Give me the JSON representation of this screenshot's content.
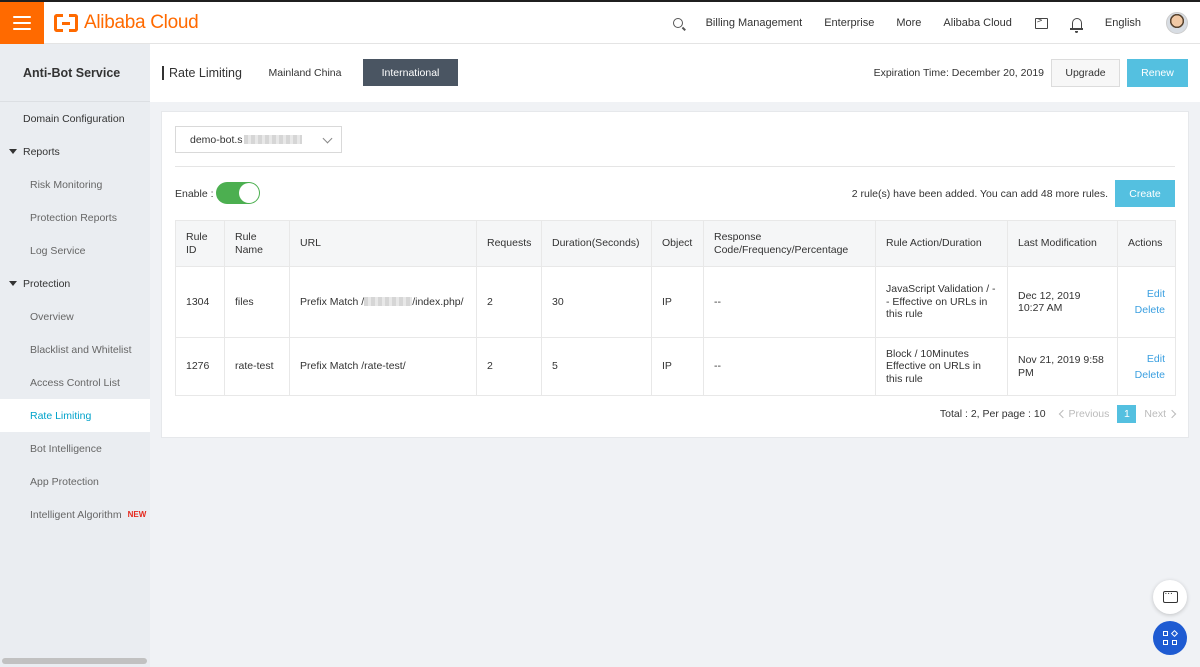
{
  "topbar": {
    "brand": "Alibaba Cloud",
    "nav": [
      "Billing Management",
      "Enterprise",
      "More",
      "Alibaba Cloud"
    ],
    "language": "English"
  },
  "sidebar": {
    "title": "Anti-Bot Service",
    "items": [
      {
        "label": "Domain Configuration"
      },
      {
        "label": "Reports"
      },
      {
        "label": "Risk Monitoring"
      },
      {
        "label": "Protection Reports"
      },
      {
        "label": "Log Service"
      },
      {
        "label": "Protection"
      },
      {
        "label": "Overview"
      },
      {
        "label": "Blacklist and Whitelist"
      },
      {
        "label": "Access Control List"
      },
      {
        "label": "Rate Limiting"
      },
      {
        "label": "Bot Intelligence"
      },
      {
        "label": "App Protection"
      },
      {
        "label": "Intelligent Algorithm",
        "badge": "NEW"
      }
    ]
  },
  "header": {
    "title": "Rate Limiting",
    "regions": [
      "Mainland China",
      "International"
    ],
    "expiration": "Expiration Time: December 20, 2019",
    "upgrade": "Upgrade",
    "renew": "Renew"
  },
  "main": {
    "domain_prefix": "demo-bot.s",
    "enable_label": "Enable :",
    "rule_count": "2 rule(s) have been added. You can add 48 more rules.",
    "create": "Create",
    "columns": [
      "Rule ID",
      "Rule Name",
      "URL",
      "Requests",
      "Duration(Seconds)",
      "Object",
      "Response Code/Frequency/Percentage",
      "Rule Action/Duration",
      "Last Modification",
      "Actions"
    ],
    "rows": [
      {
        "id": "1304",
        "name": "files",
        "url_prefix": "Prefix Match /",
        "url_suffix": "/index.php/",
        "requests": "2",
        "duration": "30",
        "object": "IP",
        "response": "--",
        "action": "JavaScript Validation / -- Effective on URLs in this rule",
        "modified": "Dec 12, 2019 10:27 AM",
        "edit": "Edit",
        "delete": "Delete"
      },
      {
        "id": "1276",
        "name": "rate-test",
        "url_prefix": "Prefix Match /rate-test/",
        "url_suffix": "",
        "requests": "2",
        "duration": "5",
        "object": "IP",
        "response": "--",
        "action": "Block / 10Minutes Effective on URLs in this rule",
        "modified": "Nov 21, 2019 9:58 PM",
        "edit": "Edit",
        "delete": "Delete"
      }
    ],
    "pager": {
      "total": "Total : 2, Per page : 10",
      "previous": "Previous",
      "page": "1",
      "next": "Next"
    }
  },
  "colors": {
    "brand": "#ff6a00",
    "accent": "#54c0e0",
    "link": "#3a9fe0",
    "toggle_on": "#4caf50",
    "apps_button": "#1e5bd2"
  },
  "icons": [
    "menu-icon",
    "search-icon",
    "terminal-icon",
    "bell-icon",
    "chevron-down-icon",
    "chat-icon",
    "apps-icon"
  ]
}
